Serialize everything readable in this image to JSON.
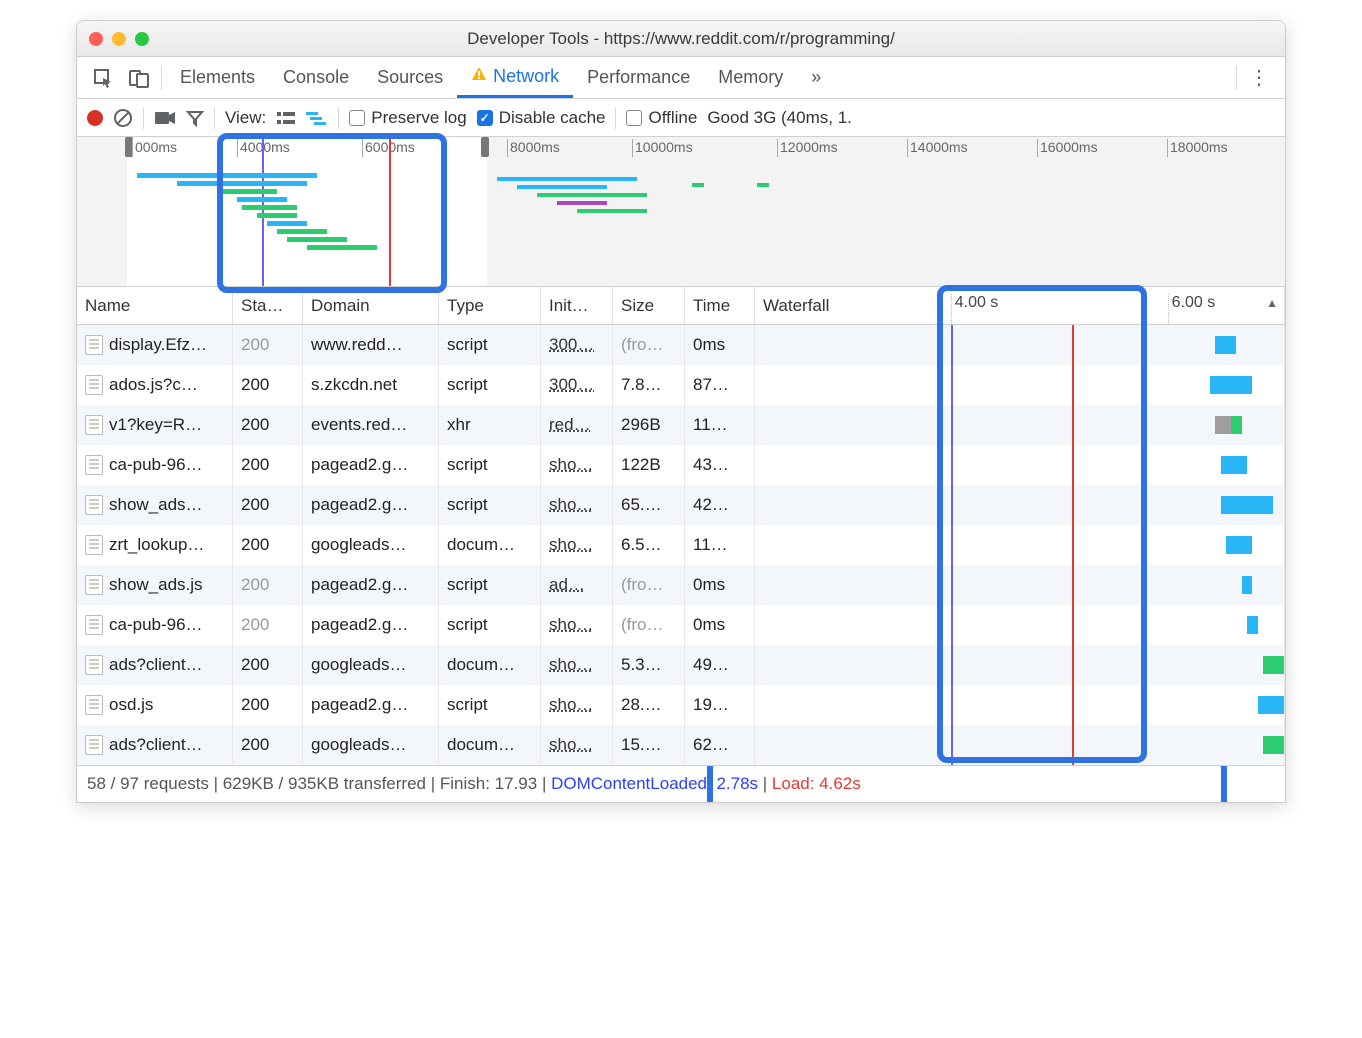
{
  "window": {
    "title": "Developer Tools - https://www.reddit.com/r/programming/"
  },
  "tabs": [
    "Elements",
    "Console",
    "Sources",
    "Network",
    "Performance",
    "Memory"
  ],
  "active_tab": "Network",
  "controls": {
    "view_label": "View:",
    "preserve_log": "Preserve log",
    "disable_cache": "Disable cache",
    "offline": "Offline",
    "throttle": "Good 3G (40ms, 1."
  },
  "timeline_ticks": [
    "000ms",
    "4000ms",
    "6000ms",
    "8000ms",
    "10000ms",
    "12000ms",
    "14000ms",
    "16000ms",
    "18000ms"
  ],
  "columns": [
    "Name",
    "Sta…",
    "Domain",
    "Type",
    "Init…",
    "Size",
    "Time",
    "Waterfall"
  ],
  "wf_ticks": [
    "4.00 s",
    "6.00 s"
  ],
  "rows": [
    {
      "name": "display.Efz…",
      "status": "200",
      "status_gray": true,
      "domain": "www.redd…",
      "type": "script",
      "init": "300…",
      "size": "(fro…",
      "size_gray": true,
      "time": "0ms",
      "bars": [
        {
          "l": 87,
          "w": 4,
          "c": "#29b6f6"
        }
      ]
    },
    {
      "name": "ados.js?c…",
      "status": "200",
      "domain": "s.zkcdn.net",
      "type": "script",
      "init": "300…",
      "size": "7.8…",
      "time": "87…",
      "bars": [
        {
          "l": 86,
          "w": 8,
          "c": "#29b6f6"
        }
      ]
    },
    {
      "name": "v1?key=R…",
      "status": "200",
      "domain": "events.red…",
      "type": "xhr",
      "init": "red…",
      "size": "296B",
      "time": "11…",
      "bars": [
        {
          "l": 87,
          "w": 3,
          "c": "#9e9e9e"
        },
        {
          "l": 90,
          "w": 2,
          "c": "#2ecc71"
        }
      ]
    },
    {
      "name": "ca-pub-96…",
      "status": "200",
      "domain": "pagead2.g…",
      "type": "script",
      "init": "sho…",
      "size": "122B",
      "time": "43…",
      "bars": [
        {
          "l": 88,
          "w": 5,
          "c": "#29b6f6"
        }
      ]
    },
    {
      "name": "show_ads…",
      "status": "200",
      "domain": "pagead2.g…",
      "type": "script",
      "init": "sho…",
      "size": "65.…",
      "time": "42…",
      "bars": [
        {
          "l": 88,
          "w": 10,
          "c": "#29b6f6"
        }
      ]
    },
    {
      "name": "zrt_lookup…",
      "status": "200",
      "domain": "googleads…",
      "type": "docum…",
      "init": "sho…",
      "size": "6.5…",
      "time": "11…",
      "bars": [
        {
          "l": 89,
          "w": 5,
          "c": "#29b6f6"
        }
      ]
    },
    {
      "name": "show_ads.js",
      "status": "200",
      "status_gray": true,
      "domain": "pagead2.g…",
      "type": "script",
      "init": "ad…",
      "size": "(fro…",
      "size_gray": true,
      "time": "0ms",
      "bars": [
        {
          "l": 92,
          "w": 2,
          "c": "#29b6f6"
        }
      ]
    },
    {
      "name": "ca-pub-96…",
      "status": "200",
      "status_gray": true,
      "domain": "pagead2.g…",
      "type": "script",
      "init": "sho…",
      "size": "(fro…",
      "size_gray": true,
      "time": "0ms",
      "bars": [
        {
          "l": 93,
          "w": 2,
          "c": "#29b6f6"
        }
      ]
    },
    {
      "name": "ads?client…",
      "status": "200",
      "domain": "googleads…",
      "type": "docum…",
      "init": "sho…",
      "size": "5.3…",
      "time": "49…",
      "bars": [
        {
          "l": 96,
          "w": 4,
          "c": "#2ecc71"
        }
      ]
    },
    {
      "name": "osd.js",
      "status": "200",
      "domain": "pagead2.g…",
      "type": "script",
      "init": "sho…",
      "size": "28.…",
      "time": "19…",
      "bars": [
        {
          "l": 95,
          "w": 5,
          "c": "#29b6f6"
        }
      ]
    },
    {
      "name": "ads?client…",
      "status": "200",
      "domain": "googleads…",
      "type": "docum…",
      "init": "sho…",
      "size": "15.…",
      "time": "62…",
      "bars": [
        {
          "l": 96,
          "w": 4,
          "c": "#2ecc71"
        }
      ]
    }
  ],
  "footer": {
    "requests": "58 / 97 requests",
    "transferred": "629KB / 935KB transferred",
    "finish": "Finish: 17.93",
    "dcl": "DOMContentLoaded: 2.78s",
    "load": "Load: 4.62s"
  }
}
